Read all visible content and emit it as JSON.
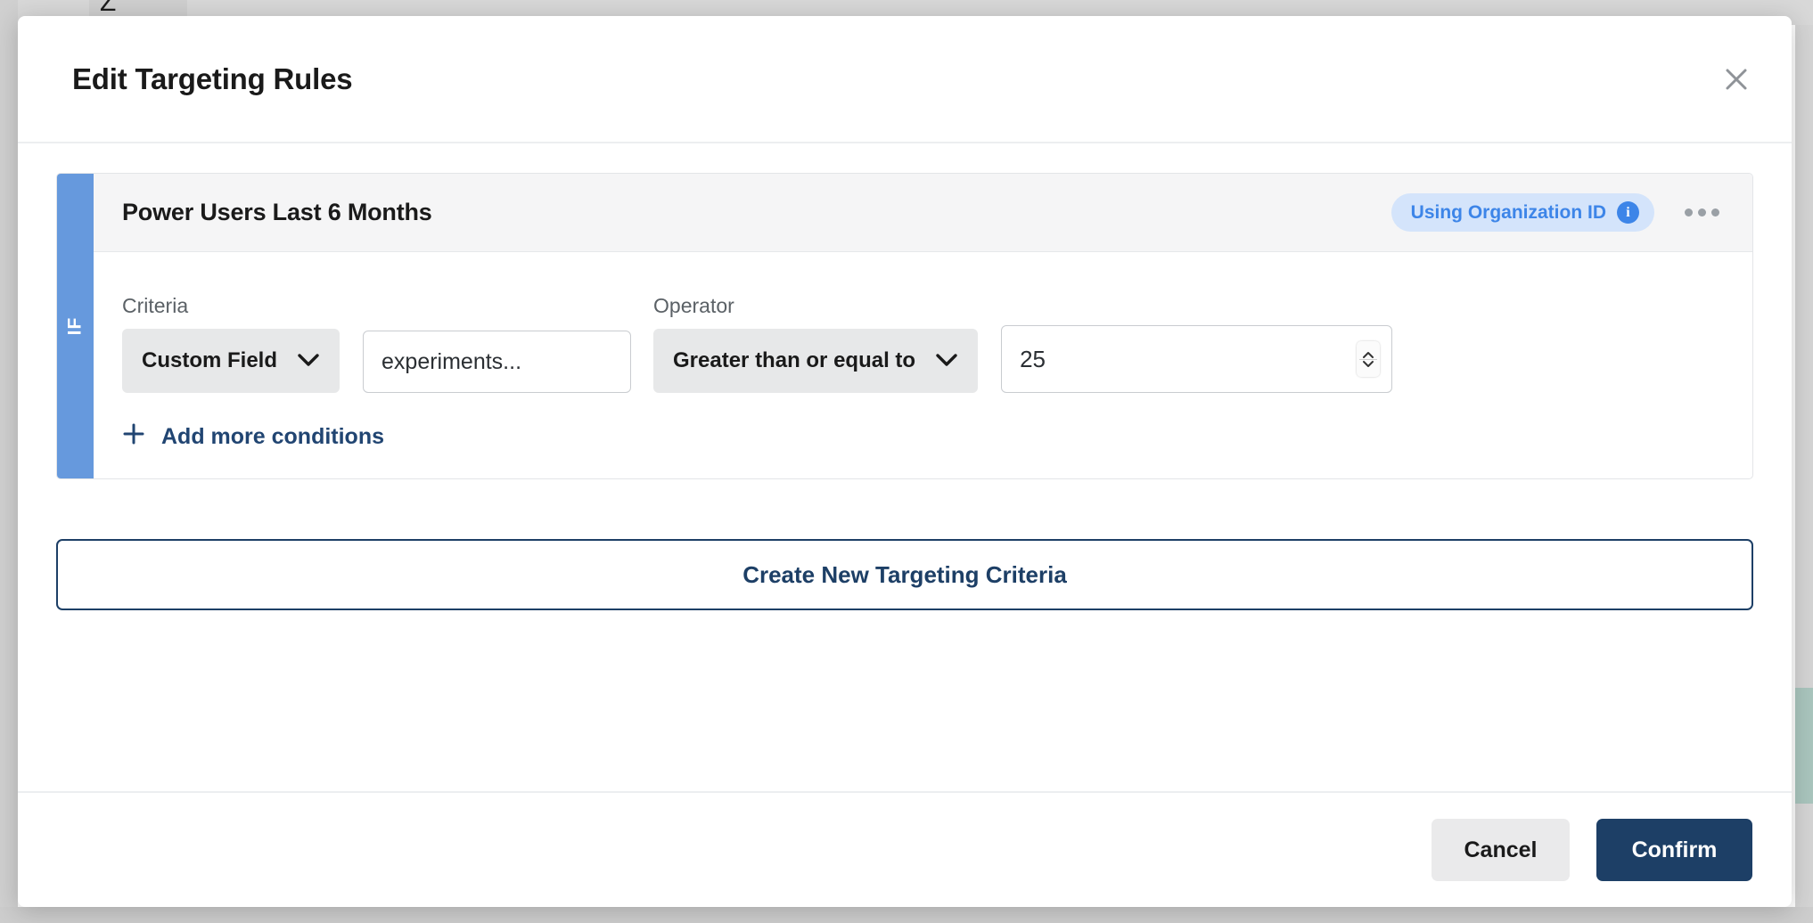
{
  "modal": {
    "title": "Edit Targeting Rules",
    "close_icon": "close-icon"
  },
  "rule": {
    "gutter_label": "IF",
    "name": "Power Users Last 6 Months",
    "badge": {
      "label": "Using Organization ID",
      "info_glyph": "i",
      "background_color": "#d4e4fb",
      "text_color": "#3d85e8"
    },
    "menu_icon": "ellipsis-icon",
    "fields": {
      "criteria_label": "Criteria",
      "criteria_value": "Custom Field",
      "criteria_field_value": "experiments...",
      "criteria_field_placeholder": "experiments...",
      "operator_label": "Operator",
      "operator_value": "Greater than or equal to",
      "threshold_value": "25"
    },
    "add_more_label": "Add more conditions",
    "add_more_icon": "plus-icon"
  },
  "actions": {
    "create_criteria_label": "Create New Targeting Criteria",
    "cancel_label": "Cancel",
    "confirm_label": "Confirm"
  },
  "background": {
    "tab_label": "Z"
  },
  "colors": {
    "accent_navy": "#1d3f66",
    "rule_gutter_blue": "#6699dd",
    "badge_blue": "#3d85e8",
    "scrollbar_thumb_green": "#a9c5bd"
  }
}
